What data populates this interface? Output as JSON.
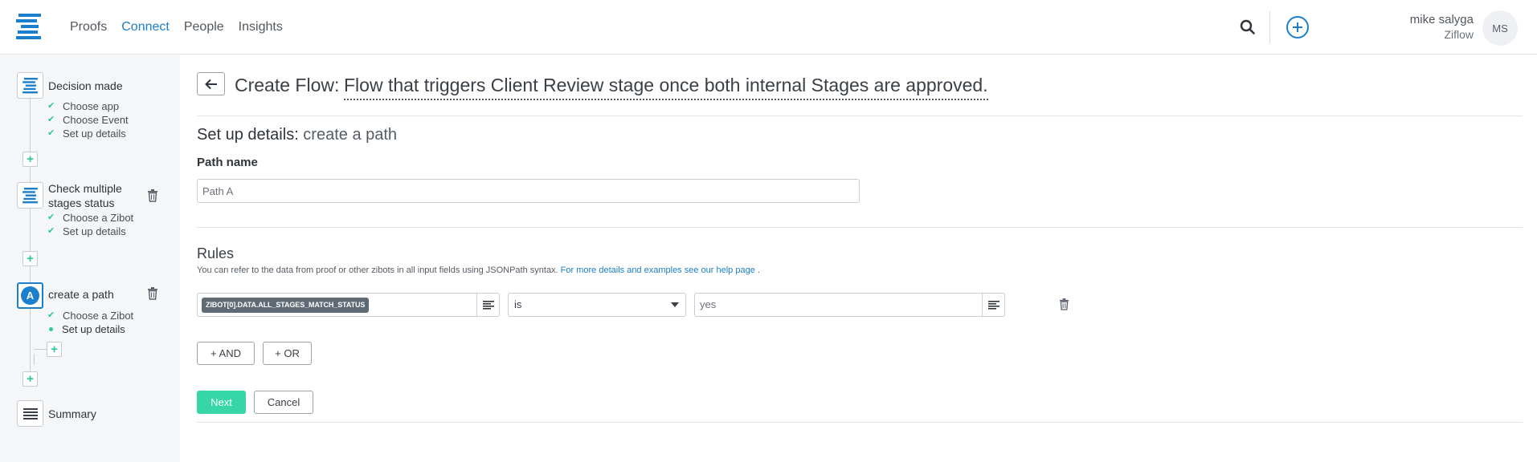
{
  "nav": {
    "logo": "ziflow-logo",
    "items": [
      {
        "label": "Proofs",
        "active": false
      },
      {
        "label": "Connect",
        "active": true
      },
      {
        "label": "People",
        "active": false
      },
      {
        "label": "Insights",
        "active": false
      }
    ],
    "search_icon": "search-icon",
    "add_icon": "plus-circle-icon"
  },
  "user": {
    "name": "mike salyga",
    "org": "Ziflow",
    "initials": "MS"
  },
  "sidebar": {
    "steps": [
      {
        "title": "Decision made",
        "icon": "ziflow-logo-icon",
        "subitems": [
          "Choose app",
          "Choose Event",
          "Set up details"
        ]
      },
      {
        "title_line1": "Check multiple",
        "title_line2": "stages status",
        "icon": "ziflow-logo-icon",
        "subitems": [
          "Choose a Zibot",
          "Set up details"
        ]
      },
      {
        "title": "create a path",
        "badge": "A",
        "subitems": [
          "Choose a Zibot",
          "Set up details"
        ]
      },
      {
        "title": "Summary",
        "icon": "summary-lines-icon"
      }
    ],
    "add_symbol": "+"
  },
  "header": {
    "label": "Create Flow:",
    "flow_name": "Flow that triggers Client Review stage once both internal Stages are approved."
  },
  "section": {
    "title_strong": "Set up details:",
    "title_weak": " create a path"
  },
  "path": {
    "label": "Path name",
    "value": "Path A"
  },
  "rules": {
    "title": "Rules",
    "help_text": "You can refer to the data from proof or other zibots in all input fields using JSONPath syntax. ",
    "help_link": "For more details and examples see our help page",
    "help_end": " .",
    "field_token": "ZIBOT[0].DATA.ALL_STAGES_MATCH_STATUS",
    "operator": "is",
    "value": "yes"
  },
  "buttons": {
    "and": "+ AND",
    "or": "+ OR",
    "next": "Next",
    "cancel": "Cancel"
  },
  "colors": {
    "accent_blue": "#1b7fcc",
    "accent_green": "#36d6a7",
    "check_green": "#2cc79a"
  }
}
